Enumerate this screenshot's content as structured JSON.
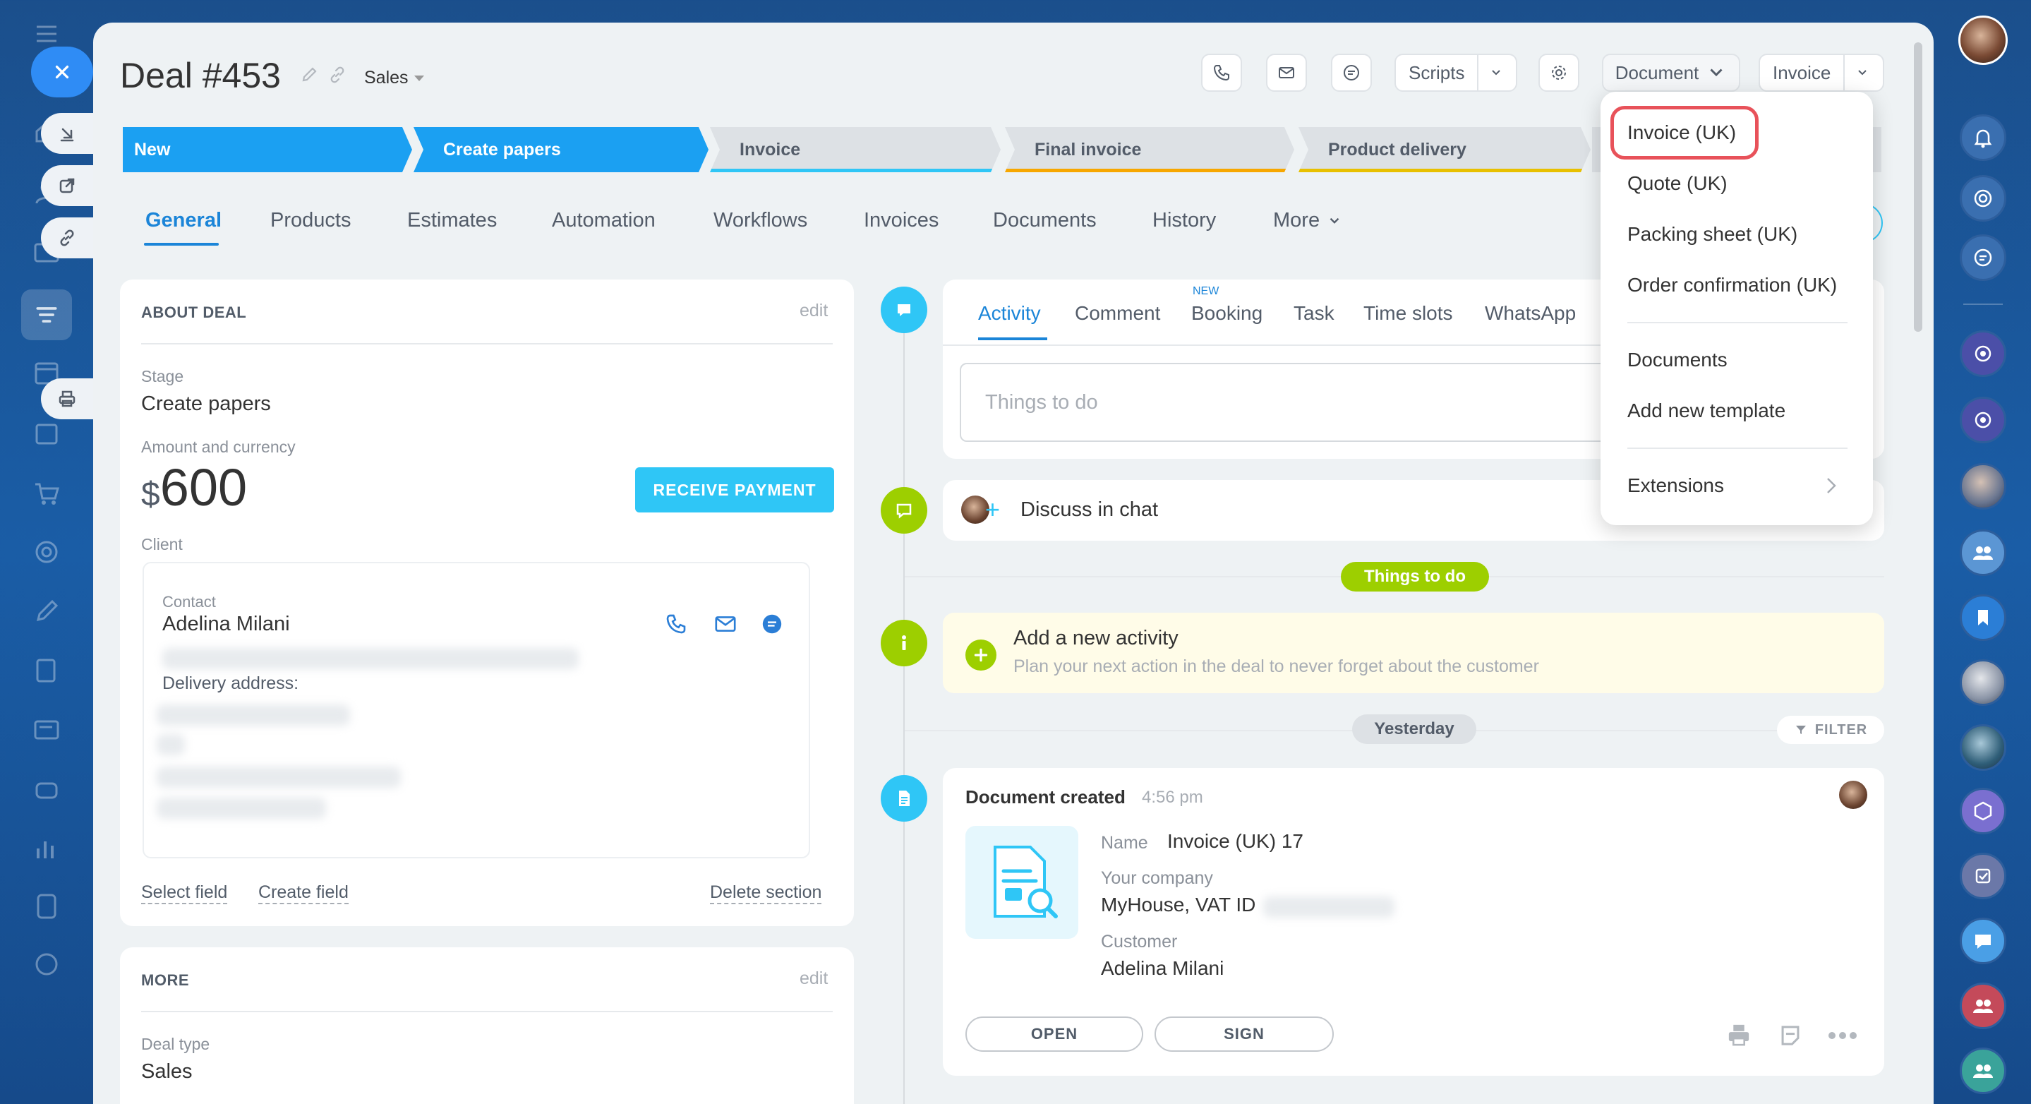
{
  "deal": {
    "title": "Deal #453",
    "funnel": "Sales"
  },
  "toolbar": {
    "scripts_label": "Scripts",
    "document_label": "Document",
    "invoice_label": "Invoice"
  },
  "stages": [
    {
      "label": "New",
      "state": "active",
      "color": "#1ba0f2"
    },
    {
      "label": "Create papers",
      "state": "active",
      "color": "#1ba0f2"
    },
    {
      "label": "Invoice",
      "state": "inactive",
      "color": "#2fc6f6"
    },
    {
      "label": "Final invoice",
      "state": "inactive",
      "color": "#f7a700"
    },
    {
      "label": "Product delivery",
      "state": "inactive",
      "color": "#e8c000"
    }
  ],
  "tabs": [
    "General",
    "Products",
    "Estimates",
    "Automation",
    "Workflows",
    "Invoices",
    "Documents",
    "History",
    "More"
  ],
  "about": {
    "section_title": "ABOUT DEAL",
    "edit": "edit",
    "stage_label": "Stage",
    "stage_value": "Create papers",
    "amount_label": "Amount and currency",
    "currency": "$",
    "amount": "600",
    "receive_payment": "RECEIVE PAYMENT",
    "client_label": "Client",
    "contact_label": "Contact",
    "contact_name": "Adelina Milani",
    "delivery_label": "Delivery address:",
    "select_field": "Select field",
    "create_field": "Create field",
    "delete_section": "Delete section"
  },
  "more_section": {
    "section_title": "MORE",
    "edit": "edit",
    "deal_type_label": "Deal type",
    "deal_type_value": "Sales"
  },
  "activity": {
    "tabs": [
      "Activity",
      "Comment",
      "Booking",
      "Task",
      "Time slots",
      "WhatsApp"
    ],
    "new_badge": "NEW",
    "placeholder": "Things to do",
    "discuss": "Discuss in chat",
    "things_pill": "Things to do",
    "add_title": "Add a new activity",
    "add_subtitle": "Plan your next action in the deal to never forget about the customer",
    "yesterday": "Yesterday",
    "filter": "FILTER"
  },
  "document_card": {
    "title": "Document created",
    "time": "4:56 pm",
    "name_label": "Name",
    "name_value": "Invoice (UK) 17",
    "company_label": "Your company",
    "company_value": "MyHouse, VAT ID",
    "customer_label": "Customer",
    "customer_value": "Adelina Milani",
    "open": "OPEN",
    "sign": "SIGN"
  },
  "dropdown": {
    "items": [
      "Invoice (UK)",
      "Quote (UK)",
      "Packing sheet (UK)",
      "Order confirmation (UK)"
    ],
    "documents": "Documents",
    "add_template": "Add new template",
    "extensions": "Extensions"
  },
  "colors": {
    "accent": "#1b85d8",
    "stage_active": "#1ba0f2",
    "highlight_red": "#e8525a",
    "green": "#9dcf00",
    "pill_green": "#9dcf00"
  }
}
